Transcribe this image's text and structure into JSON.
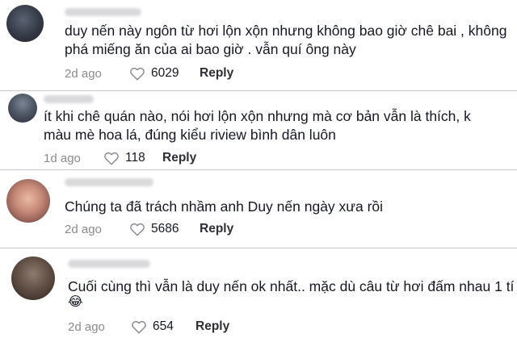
{
  "comments": [
    {
      "text": "duy nến này ngôn từ hơi lộn xộn nhưng không bao giờ chê bai , không phá miếng ăn của ai bao giờ . vẫn quí ông này",
      "time": "2d ago",
      "likes": "6029",
      "reply_label": "Reply"
    },
    {
      "text": "ít khi chê quán nào, nói hơi lộn xộn nhưng mà cơ bản vẫn là thích, k màu mè hoa lá, đúng kiểu riview bình dân luôn",
      "time": "1d ago",
      "likes": "118",
      "reply_label": "Reply"
    },
    {
      "text": "Chúng ta đã trách nhầm anh Duy nến ngày xưa rồi",
      "time": "2d ago",
      "likes": "5686",
      "reply_label": "Reply"
    },
    {
      "text": "Cuối cùng thì vẫn là duy nến ok nhất.. mặc dù câu từ hơi đấm nhau 1 tí",
      "emoji": "😂",
      "time": "2d ago",
      "likes": "654",
      "reply_label": "Reply"
    }
  ],
  "icons": {
    "like": "heart-outline-icon"
  },
  "colors": {
    "text": "#161823",
    "muted": "#8a8b91",
    "divider": "#c8c8c8"
  }
}
